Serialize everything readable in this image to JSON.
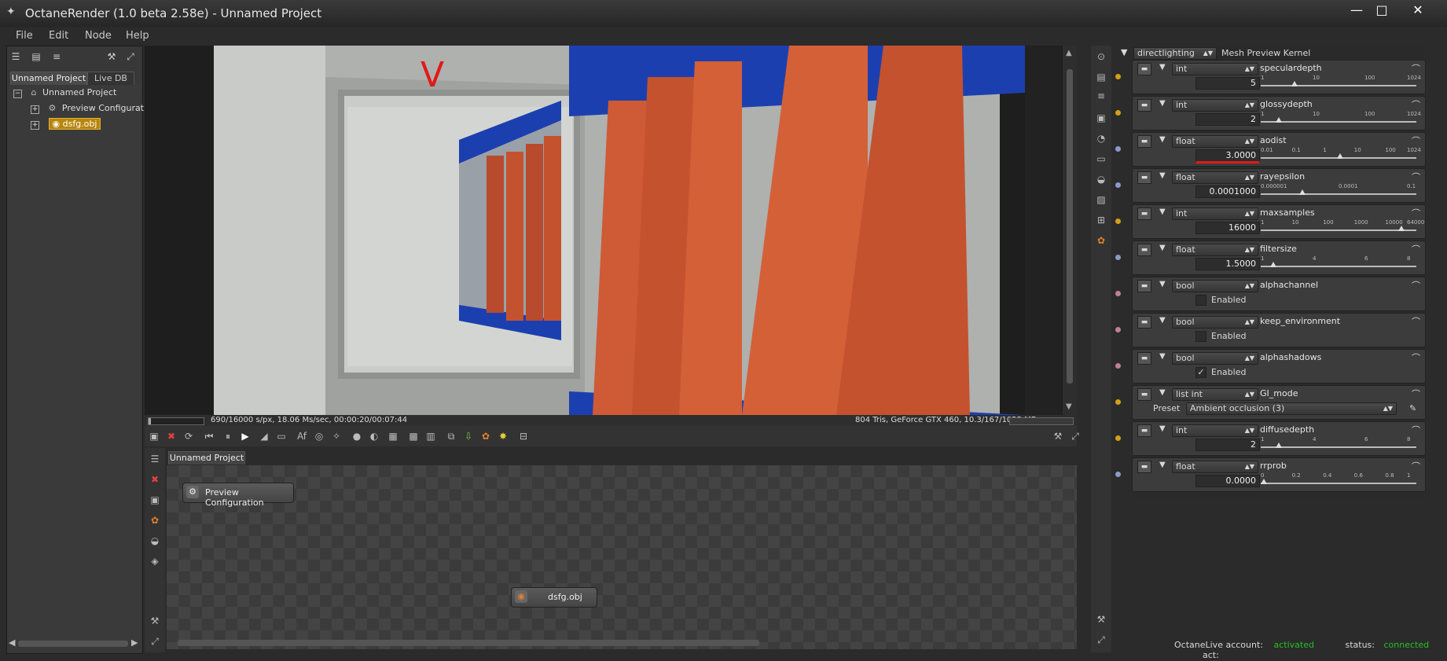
{
  "window": {
    "title": "OctaneRender (1.0 beta 2.58e) - Unnamed Project",
    "min": "—",
    "max": "□",
    "close": "✕"
  },
  "menu": [
    "File",
    "Edit",
    "Node",
    "Help"
  ],
  "left_panel": {
    "tabs": [
      "Unnamed Project",
      "Live DB"
    ],
    "tree": {
      "root": "Unnamed Project",
      "items": [
        "Preview Configuration",
        "dsfg.obj"
      ]
    }
  },
  "viewport": {
    "annotation": "V",
    "status_left": "690/16000 s/px, 18.06 Ms/sec, 00:00:20/00:07:44",
    "status_right": "804 Tris, GeForce GTX 460, 10.3/167/1023 MB",
    "progress": 0.04
  },
  "graph": {
    "tab": "Unnamed Project",
    "nodes": {
      "preview": "Preview Configuration",
      "mesh": "dsfg.obj"
    }
  },
  "kernel": {
    "selected": "directlighting",
    "label": "Mesh Preview Kernel"
  },
  "params": [
    {
      "type": "int",
      "name": "speculardepth",
      "value": "5",
      "ticks": [
        "1",
        "10",
        "100",
        "1024"
      ],
      "pos": 0.2,
      "pin": "#d4a017"
    },
    {
      "type": "int",
      "name": "glossydepth",
      "value": "2",
      "ticks": [
        "1",
        "10",
        "100",
        "1024"
      ],
      "pos": 0.1,
      "pin": "#d4a017"
    },
    {
      "type": "float",
      "name": "aodist",
      "value": "3.0000",
      "ticks": [
        "0.01",
        "0.1",
        "1",
        "10",
        "100",
        "1024"
      ],
      "pos": 0.5,
      "pin": "#8a9ac8",
      "highlight": true
    },
    {
      "type": "float",
      "name": "rayepsilon",
      "value": "0.0001000",
      "ticks": [
        "0.000001",
        "0.0001",
        "0.1"
      ],
      "pos": 0.25,
      "pin": "#8a9ac8"
    },
    {
      "type": "int",
      "name": "maxsamples",
      "value": "16000",
      "ticks": [
        "1",
        "10",
        "100",
        "1000",
        "10000",
        "64000"
      ],
      "pos": 0.9,
      "pin": "#d4a017"
    },
    {
      "type": "float",
      "name": "filtersize",
      "value": "1.5000",
      "ticks": [
        "1",
        "4",
        "6",
        "8"
      ],
      "pos": 0.06,
      "pin": "#8a9ac8"
    }
  ],
  "bool_params": [
    {
      "type": "bool",
      "name": "alphachannel",
      "label": "Enabled",
      "checked": false
    },
    {
      "type": "bool",
      "name": "keep_environment",
      "label": "Enabled",
      "checked": false
    },
    {
      "type": "bool",
      "name": "alphashadows",
      "label": "Enabled",
      "checked": true
    }
  ],
  "gi_mode": {
    "type": "list int",
    "name": "GI_mode",
    "preset_label": "Preset",
    "preset": "Ambient occlusion (3)"
  },
  "params2": [
    {
      "type": "int",
      "name": "diffusedepth",
      "value": "2",
      "ticks": [
        "1",
        "4",
        "6",
        "8"
      ],
      "pos": 0.1,
      "pin": "#d4a017"
    },
    {
      "type": "float",
      "name": "rrprob",
      "value": "0.0000",
      "ticks": [
        "0",
        "0.2",
        "0.4",
        "0.6",
        "0.8",
        "1"
      ],
      "pos": 0.0,
      "pin": "#8a9ac8"
    }
  ],
  "status": {
    "account_label": "OctaneLive account:",
    "account_value": "activated",
    "status_label": "status:",
    "status_value": "connected",
    "act_label": "act:",
    "value_color": "#22c022"
  }
}
